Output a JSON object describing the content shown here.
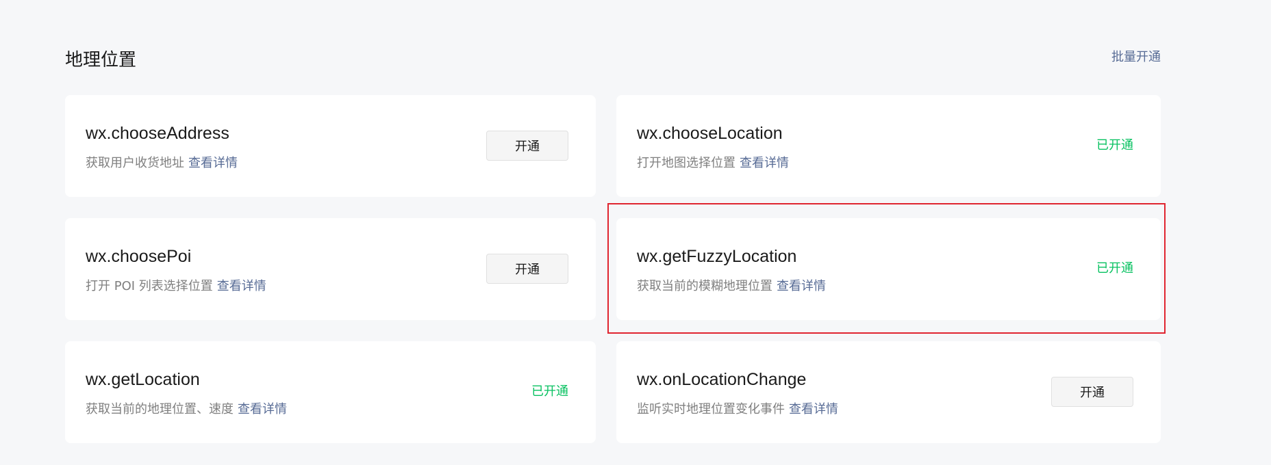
{
  "section": {
    "title": "地理位置",
    "batch_label": "批量开通"
  },
  "cards": [
    {
      "name": "wx.chooseAddress",
      "description": "获取用户收货地址",
      "detail_label": "查看详情",
      "action_label": "开通",
      "opened": false
    },
    {
      "name": "wx.chooseLocation",
      "description": "打开地图选择位置",
      "detail_label": "查看详情",
      "status_label": "已开通",
      "opened": true
    },
    {
      "name": "wx.choosePoi",
      "description": "打开 POI 列表选择位置",
      "detail_label": "查看详情",
      "action_label": "开通",
      "opened": false
    },
    {
      "name": "wx.getFuzzyLocation",
      "description": "获取当前的模糊地理位置",
      "detail_label": "查看详情",
      "status_label": "已开通",
      "opened": true,
      "highlighted": true
    },
    {
      "name": "wx.getLocation",
      "description": "获取当前的地理位置、速度",
      "detail_label": "查看详情",
      "status_label": "已开通",
      "opened": true
    },
    {
      "name": "wx.onLocationChange",
      "description": "监听实时地理位置变化事件",
      "detail_label": "查看详情",
      "action_label": "开通",
      "opened": false
    }
  ],
  "colors": {
    "background": "#f6f7f9",
    "card": "#ffffff",
    "link": "#576b95",
    "status_green": "#07c160",
    "highlight_border": "#e0242f"
  }
}
